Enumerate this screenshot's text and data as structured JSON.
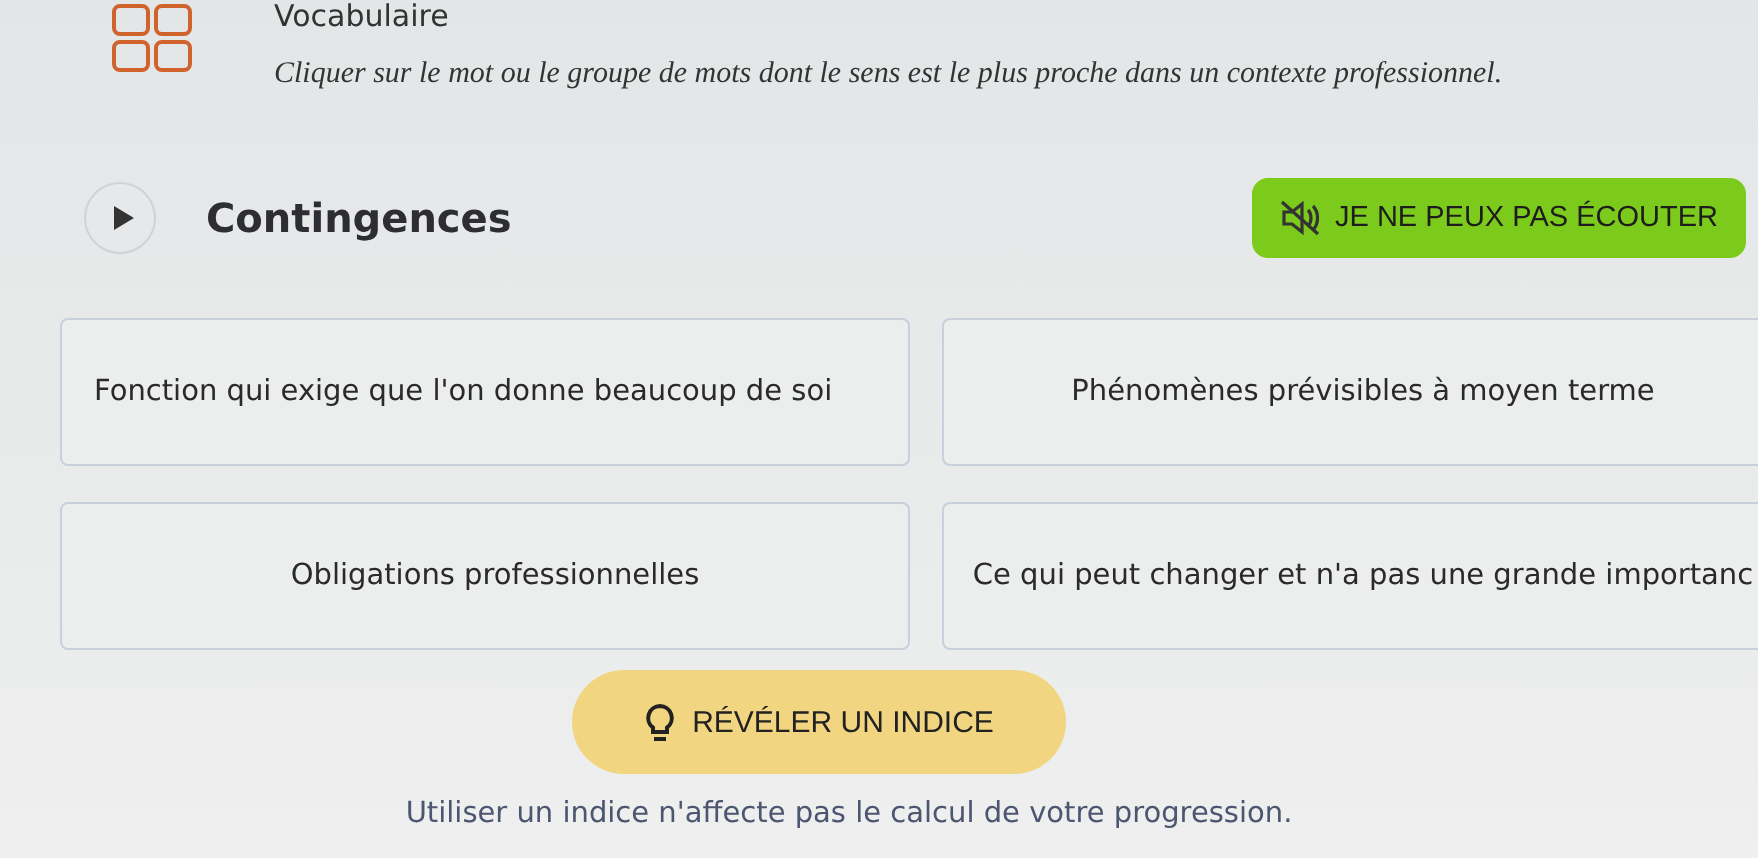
{
  "header": {
    "title": "Vocabulaire",
    "instruction": "Cliquer sur le mot ou le groupe de mots dont le sens est le plus proche dans un contexte professionnel."
  },
  "word": {
    "text": "Contingences",
    "audio_button": "JE NE PEUX PAS ÉCOUTER"
  },
  "choices": [
    {
      "text": "Fonction qui exige que l'on donne beaucoup de soi"
    },
    {
      "text": "Phénomènes prévisibles à moyen terme"
    },
    {
      "text": "Obligations professionnelles"
    },
    {
      "text": "Ce qui peut changer et n'a pas une grande importanc"
    }
  ],
  "hint_button": "RÉVÉLER UN INDICE",
  "note": "Utiliser un indice n'affecte pas le calcul de votre progression."
}
